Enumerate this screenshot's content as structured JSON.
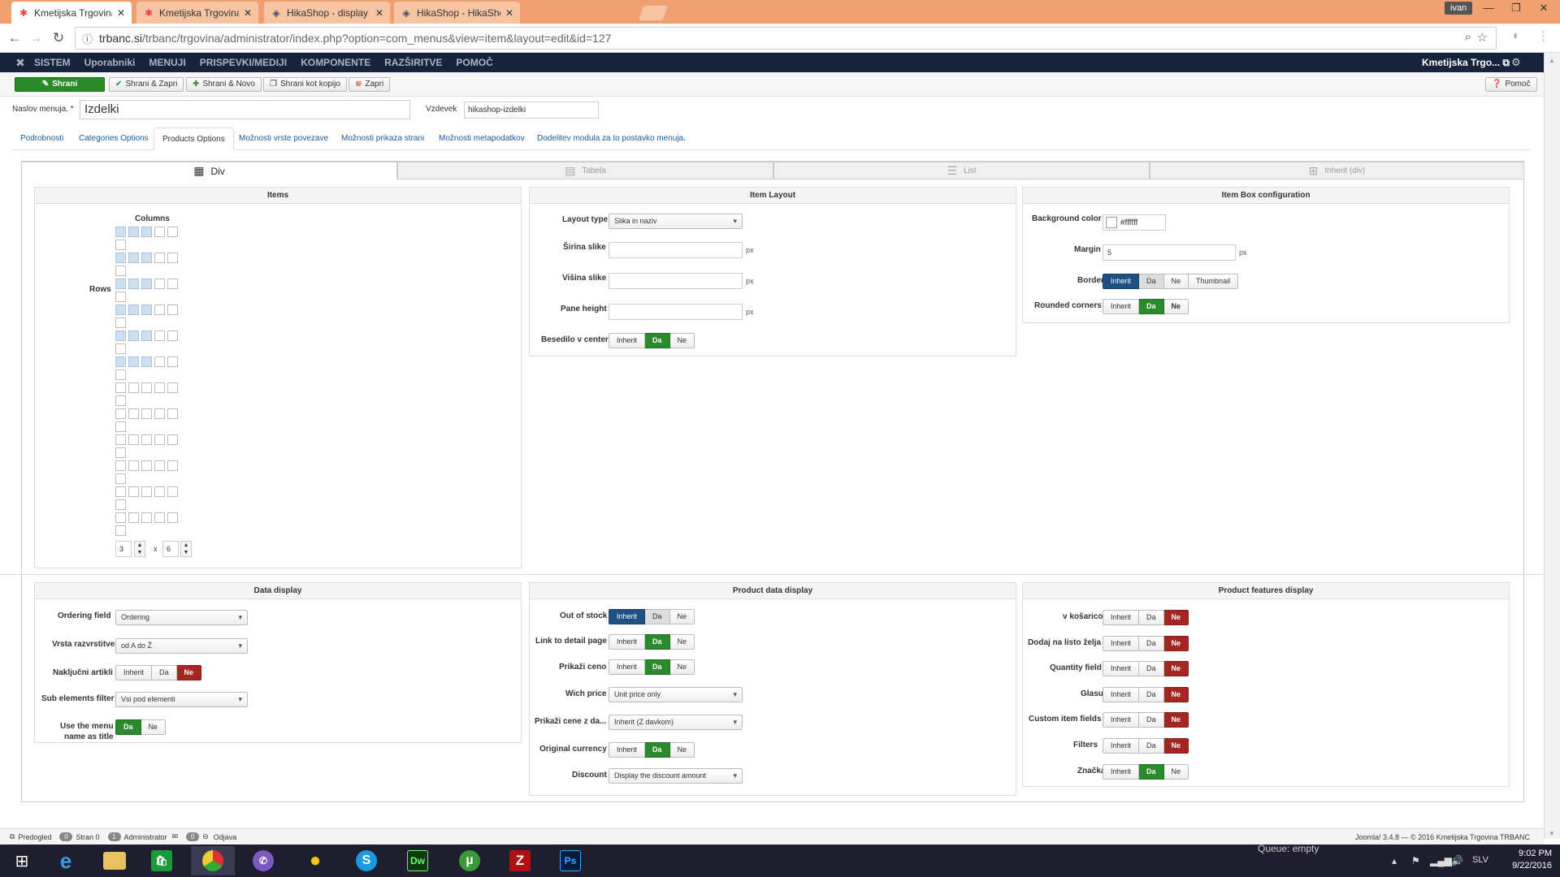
{
  "browser": {
    "tabs": [
      {
        "title": "Kmetijska Trgovina TRBA",
        "icon": "joomla-icon",
        "active": true
      },
      {
        "title": "Kmetijska Trgovina TRBA",
        "icon": "joomla-icon",
        "active": false
      },
      {
        "title": "HikaShop - display by co",
        "icon": "hikashop-icon",
        "active": false
      },
      {
        "title": "HikaShop - HikaShop - F",
        "icon": "hikashop-icon",
        "active": false
      }
    ],
    "user": "ivan",
    "url_host": "trbanc.si",
    "url_path": "/trbanc/trgovina/administrator/index.php?option=com_menus&view=item&layout=edit&id=127"
  },
  "admin_nav": {
    "items": [
      "SISTEM",
      "Uporabniki",
      "MENUJI",
      "PRISPEVKI/MEDIJI",
      "KOMPONENTE",
      "RAZŠIRITVE",
      "POMOČ"
    ],
    "site": "Kmetijska Trgo..."
  },
  "toolbar": {
    "save": "Shrani",
    "save_close": "Shrani & Zapri",
    "save_new": "Shrani & Novo",
    "save_copy": "Shrani kot kopijo",
    "close": "Zapri",
    "help": "Pomoč"
  },
  "form": {
    "title_label": "Naslov menuja. *",
    "title_value": "Izdelki",
    "alias_label": "Vzdevek",
    "alias_value": "hikashop-izdelki"
  },
  "tabs": [
    "Podrobnosti",
    "Categories Options",
    "Products Options",
    "Možnosti vrste povezave",
    "Možnosti prikaza strani",
    "Možnosti metapodatkov",
    "Dodelitev modula za to postavko menuja."
  ],
  "modes": [
    "Div",
    "Tabela",
    "List",
    "Inherit (div)"
  ],
  "items_panel": {
    "title": "Items",
    "columns_label": "Columns",
    "rows_label": "Rows",
    "columns_value": "3",
    "rows_value": "6",
    "x": "x",
    "selected_columns": 3,
    "selected_rows": 6
  },
  "item_layout": {
    "title": "Item Layout",
    "layout_type_label": "Layout type",
    "layout_type_value": "Slika in naziv",
    "width_label": "Širina slike",
    "height_label": "Višina slike",
    "pane_height_label": "Pane height",
    "center_label": "Besedilo v center",
    "px": "px",
    "center_options": [
      "Inherit",
      "Da",
      "Ne"
    ]
  },
  "box_config": {
    "title": "Item Box configuration",
    "bg_label": "Background color",
    "bg_value": "#ffffff",
    "margin_label": "Margin",
    "margin_value": "5",
    "px": "px",
    "border_label": "Border",
    "border_options": [
      "Inherit",
      "Da",
      "Ne",
      "Thumbnail"
    ],
    "rounded_label": "Rounded corners",
    "rounded_options": [
      "Inherit",
      "Da",
      "Ne"
    ]
  },
  "data_display": {
    "title": "Data display",
    "ordering_label": "Ordering field",
    "ordering_value": "Ordering",
    "sort_label": "Vrsta razvrstitve",
    "sort_value": "od A do Ž",
    "random_label": "Naključni artikli",
    "random_options": [
      "Inherit",
      "Da",
      "Ne"
    ],
    "sub_label": "Sub elements filter",
    "sub_value": "Vsi pod elementi",
    "menu_title_label_1": "Use the menu",
    "menu_title_label_2": "name as title",
    "menu_title_options": [
      "Da",
      "Ne"
    ]
  },
  "product_data": {
    "title": "Product data display",
    "out_of_stock_label": "Out of stock",
    "link_label": "Link to detail page",
    "show_price_label": "Prikaži ceno",
    "wich_price_label": "Wich price",
    "wich_price_value": "Unit price only",
    "price_tax_label": "Prikaži cene z da...",
    "price_tax_value": "Inherit (Z davkom)",
    "orig_currency_label": "Original currency",
    "discount_label": "Discount",
    "discount_value": "Display the discount amount",
    "options": [
      "Inherit",
      "Da",
      "Ne"
    ]
  },
  "features": {
    "title": "Product features display",
    "labels": [
      "v košarico",
      "Dodaj na listo želja",
      "Quantity field",
      "Glasuj",
      "Custom item fields",
      "Filters",
      "Značka"
    ],
    "options": [
      "Inherit",
      "Da",
      "Ne"
    ]
  },
  "statusbar": {
    "preview": "Predogled",
    "count1": "0",
    "visitors": "Stran 0",
    "count2": "1",
    "admin": "Administrator",
    "count3": "0",
    "logout": "Odjava",
    "footer": "Joomla! 3.4.8 — © 2016 Kmetijska Trgovina TRBANC"
  },
  "taskbar": {
    "queue": "Queue: empty",
    "lang": "SLV",
    "time": "9:02 PM",
    "date": "9/22/2016"
  },
  "colors": {
    "accent_blue": "#205081",
    "accent_green": "#2b8a2b",
    "accent_red": "#a52620",
    "admin_bar": "#17233b"
  }
}
